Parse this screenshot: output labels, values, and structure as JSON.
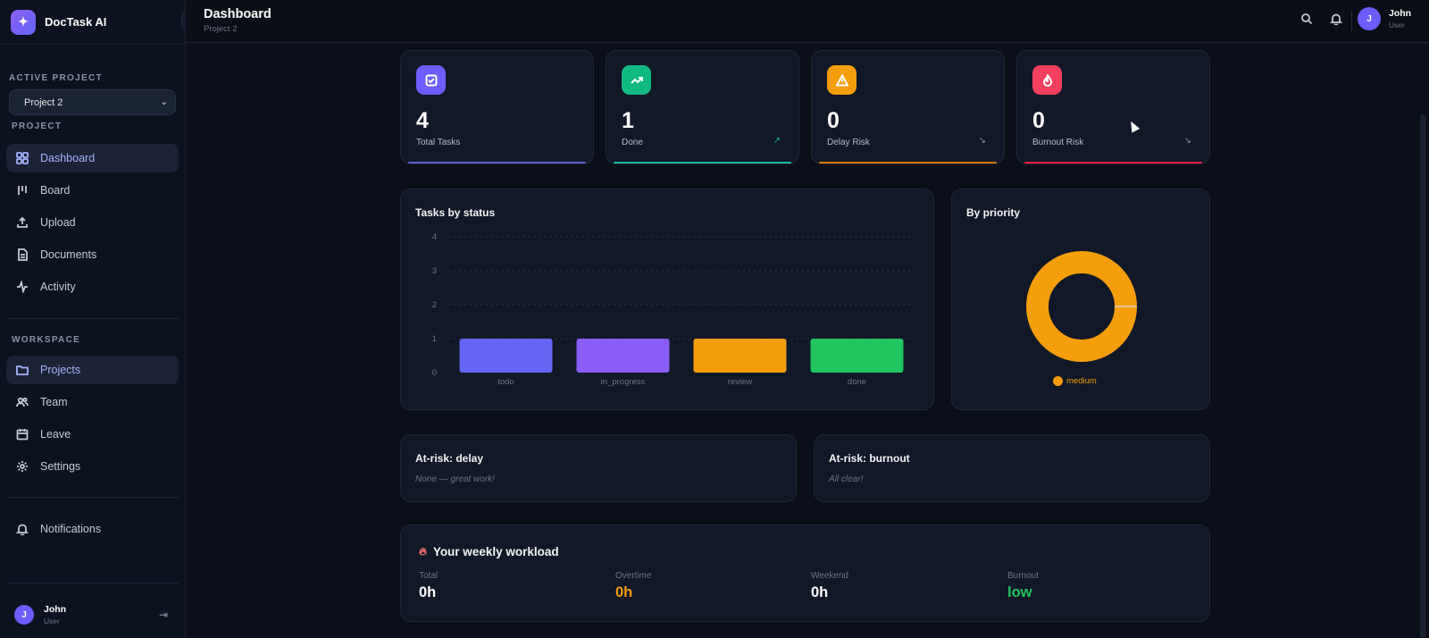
{
  "app": {
    "name": "DocTask AI",
    "logo_icon": "sparkles-icon"
  },
  "sidebar": {
    "active_project_label": "ACTIVE PROJECT",
    "project_select_value": "Project 2",
    "project_section_label": "PROJECT",
    "project_items": [
      {
        "label": "Dashboard",
        "icon": "dashboard-icon",
        "active": true
      },
      {
        "label": "Board",
        "icon": "board-icon",
        "active": false
      },
      {
        "label": "Upload",
        "icon": "upload-icon",
        "active": false
      },
      {
        "label": "Documents",
        "icon": "document-icon",
        "active": false
      },
      {
        "label": "Activity",
        "icon": "activity-icon",
        "active": false
      }
    ],
    "workspace_section_label": "WORKSPACE",
    "workspace_items": [
      {
        "label": "Projects",
        "icon": "folder-icon",
        "active": true
      },
      {
        "label": "Team",
        "icon": "team-icon",
        "active": false
      },
      {
        "label": "Leave",
        "icon": "calendar-icon",
        "active": false
      },
      {
        "label": "Settings",
        "icon": "gear-icon",
        "active": false
      }
    ],
    "notifications_label": "Notifications",
    "user": {
      "initial": "J",
      "name": "John",
      "role": "User"
    }
  },
  "topbar": {
    "title": "Dashboard",
    "subtitle": "Project 2",
    "user": {
      "initial": "J",
      "name": "John",
      "role": "User"
    }
  },
  "stats": [
    {
      "value": "4",
      "label": "Total Tasks",
      "icon": "checkbox-icon",
      "color": "#6d5dfc",
      "arrow": "",
      "bar": "#5b5bd6"
    },
    {
      "value": "1",
      "label": "Done",
      "icon": "trend-up-icon",
      "color": "#10b981",
      "arrow": "↗",
      "bar": "#14b8a6"
    },
    {
      "value": "0",
      "label": "Delay Risk",
      "icon": "warning-icon",
      "color": "#f59e0b",
      "arrow": "↘",
      "bar": "#d97706"
    },
    {
      "value": "0",
      "label": "Burnout Risk",
      "icon": "flame-icon",
      "color": "#f43f5e",
      "arrow": "↘",
      "bar": "#e11d48"
    }
  ],
  "status_chart": {
    "title": "Tasks by status",
    "chart_data": {
      "type": "bar",
      "categories": [
        "todo",
        "in_progress",
        "review",
        "done"
      ],
      "values": [
        1,
        1,
        1,
        1
      ],
      "colors": [
        "#6366f1",
        "#8b5cf6",
        "#f59e0b",
        "#22c55e"
      ],
      "ylim": [
        0,
        4
      ],
      "yticks": [
        0,
        1,
        2,
        3,
        4
      ],
      "grid": true
    }
  },
  "priority_chart": {
    "title": "By priority",
    "chart_data": {
      "type": "pie",
      "donut": true,
      "labels": [
        "medium"
      ],
      "values": [
        1
      ],
      "colors": [
        "#f59e0b"
      ]
    }
  },
  "at_risk_delay": {
    "title": "At-risk: delay",
    "message": "None — great work!"
  },
  "at_risk_burnout": {
    "title": "At-risk: burnout",
    "message": "All clear!"
  },
  "workload": {
    "title": "Your weekly workload",
    "items": [
      {
        "label": "Total",
        "value": "0h",
        "color": "#ffffff"
      },
      {
        "label": "Overtime",
        "value": "0h",
        "color": "#f59e0b"
      },
      {
        "label": "Weekend",
        "value": "0h",
        "color": "#ffffff"
      },
      {
        "label": "Burnout",
        "value": "low",
        "color": "#22c55e"
      }
    ]
  }
}
